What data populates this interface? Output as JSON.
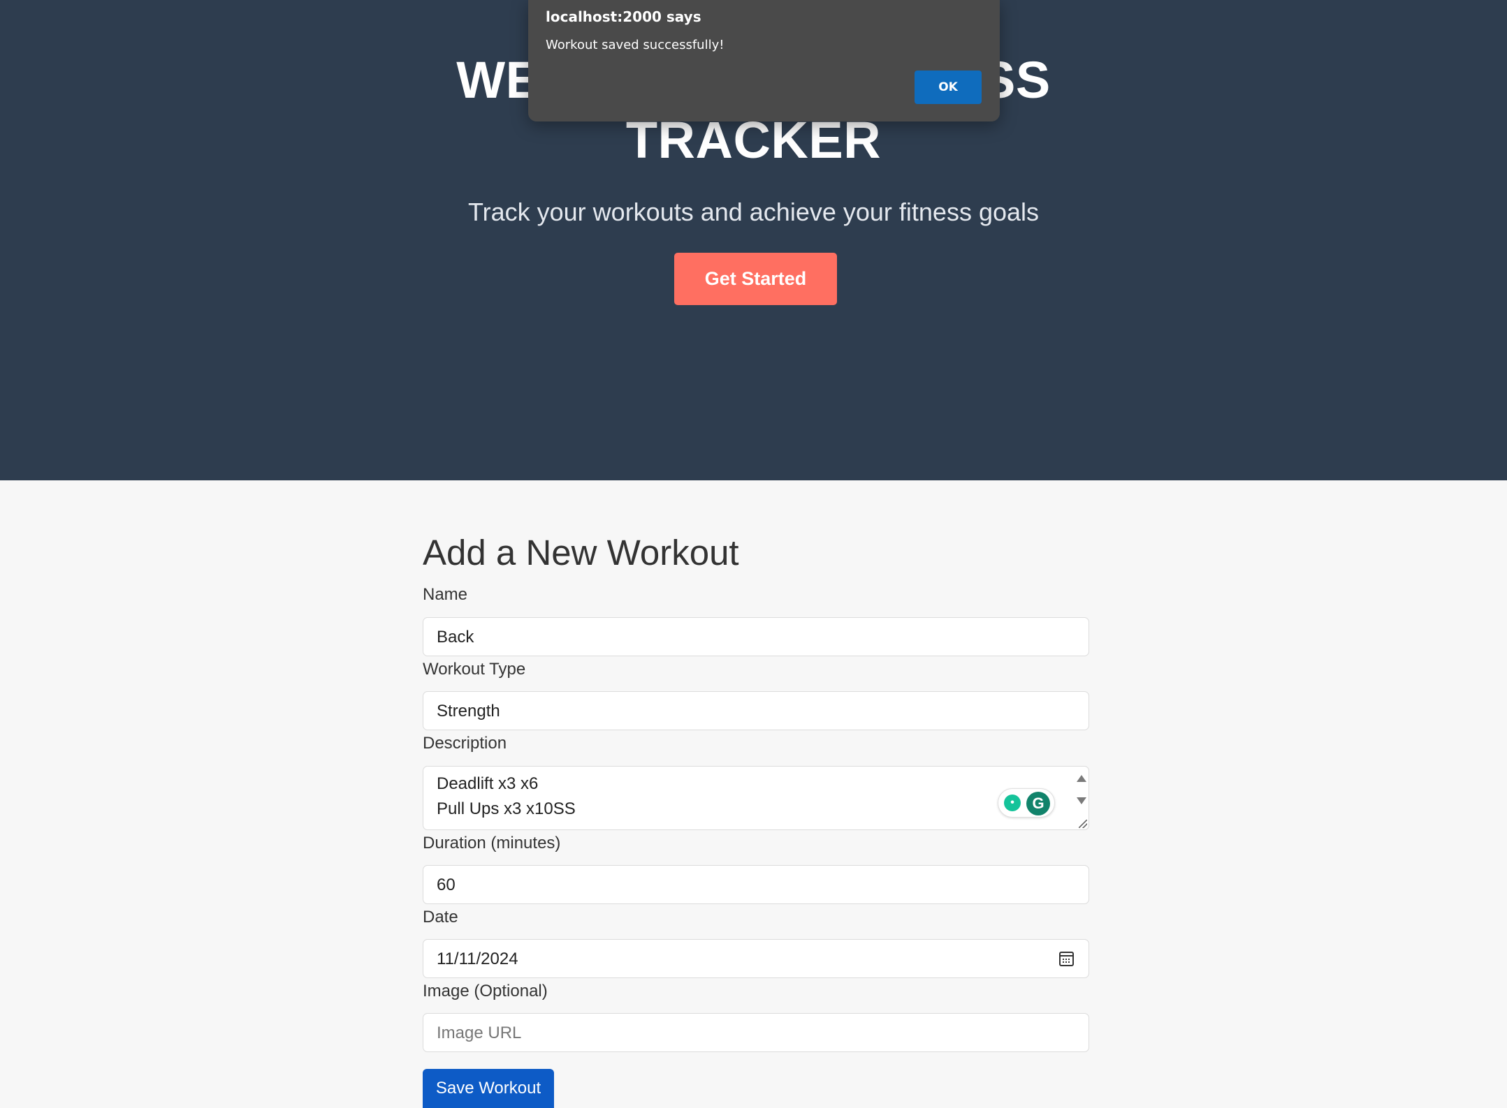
{
  "hero": {
    "title_line1": "WELCOME TO FITNESS",
    "title_line2": "TRACKER",
    "subtitle": "Track your workouts and achieve your fitness goals",
    "cta_label": "Get Started",
    "bg_color": "#2e3d4f",
    "cta_color": "#ff6f61"
  },
  "dialog": {
    "title": "localhost:2000 says",
    "message": "Workout saved successfully!",
    "ok_label": "OK"
  },
  "form": {
    "heading": "Add a New Workout",
    "name_label": "Name",
    "name_value": "Back",
    "type_label": "Workout Type",
    "type_value": "Strength",
    "description_label": "Description",
    "description_lines": [
      "Deadlift x3 x6",
      "Pull Ups x3 x10SS"
    ],
    "duration_label": "Duration (minutes)",
    "duration_value": "60",
    "date_label": "Date",
    "date_value": "11/11/2024",
    "image_label": "Image (Optional)",
    "image_placeholder": "Image URL",
    "save_label": "Save Workout",
    "save_color": "#0d5bc6"
  },
  "icons": {
    "calendar": "calendar-icon",
    "grammarly_bulb": "grammarly-bulb-icon",
    "grammarly_logo": "grammarly-logo-icon"
  }
}
